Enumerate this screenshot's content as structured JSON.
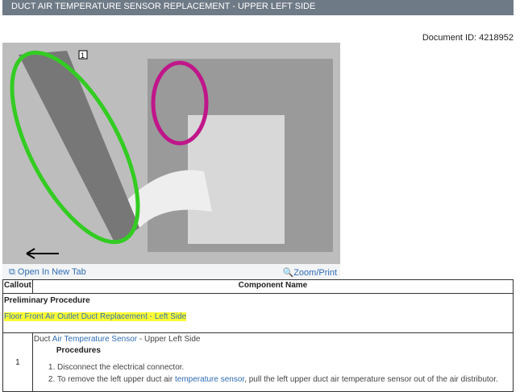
{
  "header": {
    "title": "DUCT AIR TEMPERATURE SENSOR REPLACEMENT - UPPER LEFT SIDE"
  },
  "document_id": "Document ID: 4218952",
  "figure": {
    "callout": "1",
    "open_tab": "Open In New Tab",
    "zoom_print": "Zoom/Print"
  },
  "table": {
    "headers": [
      "Callout",
      "Component Name"
    ],
    "preliminary_label": "Preliminary Procedure",
    "preliminary_link": "Floor Front Air Outlet Duct Replacement - Left Side",
    "row": {
      "callout": "1",
      "prefix": "Duct ",
      "link": "Air Temperature Sensor",
      "suffix": " - Upper Left Side",
      "procedures": "Procedures",
      "step1": "1. Disconnect the electrical connector.",
      "step2_a": "2. To remove the left upper duct air ",
      "step2_link": "temperature sensor",
      "step2_b": ", pull the left upper duct air temperature sensor out of the air distributor."
    }
  }
}
